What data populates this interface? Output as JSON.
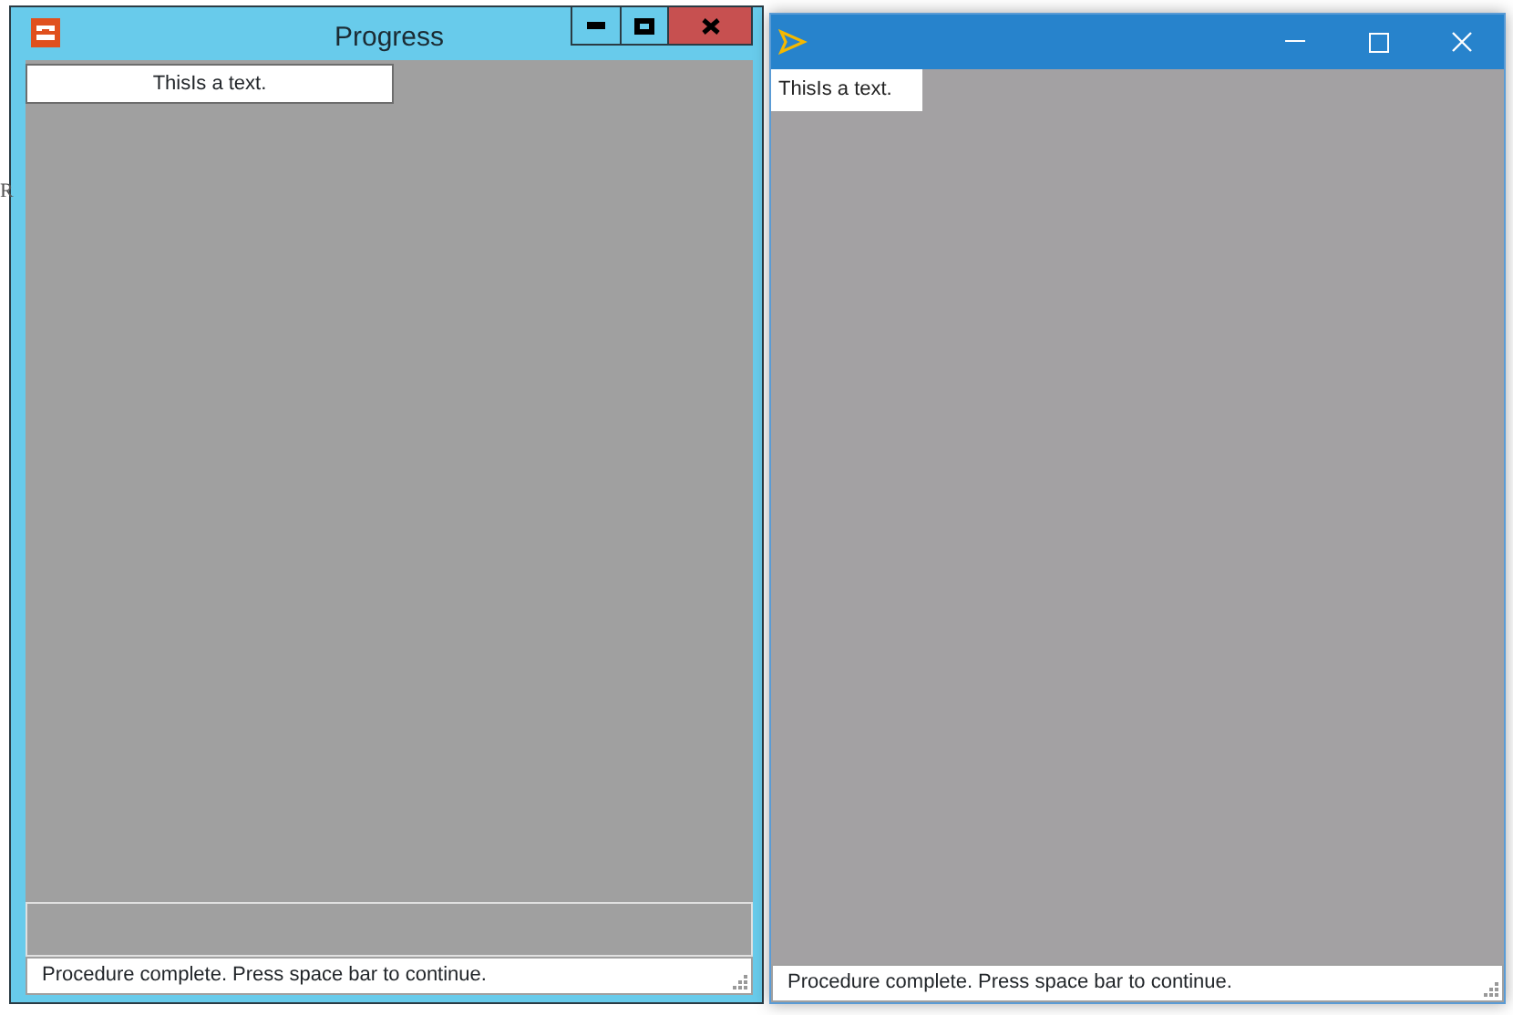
{
  "background_text": "R",
  "windows": [
    {
      "kind": "classic",
      "title": "Progress",
      "label": "ThisIs a text.",
      "progress": {
        "level": 0
      },
      "status": "Procedure complete. Press space bar to continue."
    },
    {
      "kind": "modern",
      "label": "ThisIs a text.",
      "status": "Procedure complete. Press space bar to continue."
    }
  ]
}
